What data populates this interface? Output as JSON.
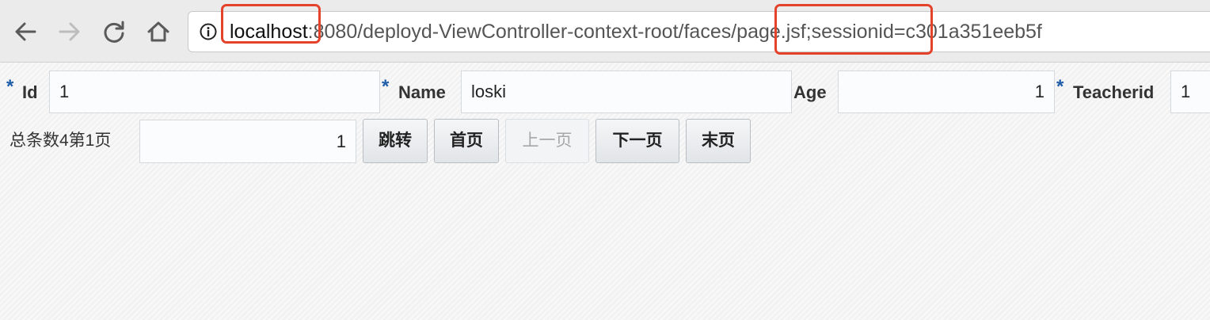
{
  "browser": {
    "url": {
      "host": "localhost",
      "rest": ":8080/deployd-ViewController-context-root/faces/page.jsf;sessionid=c301a351eeb5f"
    }
  },
  "form": {
    "fields": [
      {
        "label": "Id",
        "required": true,
        "value": "1"
      },
      {
        "label": "Name",
        "required": true,
        "value": "loski"
      },
      {
        "label": "Age",
        "required": false,
        "value": "1"
      },
      {
        "label": "Teacherid",
        "required": true,
        "value": "1"
      }
    ],
    "required_marker": "*"
  },
  "pager": {
    "summary": "总条数4第1页",
    "page_input_value": "1",
    "buttons": {
      "jump": "跳转",
      "first": "首页",
      "prev": "上一页",
      "next": "下一页",
      "last": "末页"
    },
    "prev_disabled": true
  },
  "colors": {
    "required_star": "#1e5da8",
    "annotation": "#e5422b",
    "toolbar_bg": "#ebebeb"
  },
  "icons": [
    "back-arrow-icon",
    "forward-arrow-icon",
    "reload-icon",
    "home-icon",
    "info-icon"
  ]
}
